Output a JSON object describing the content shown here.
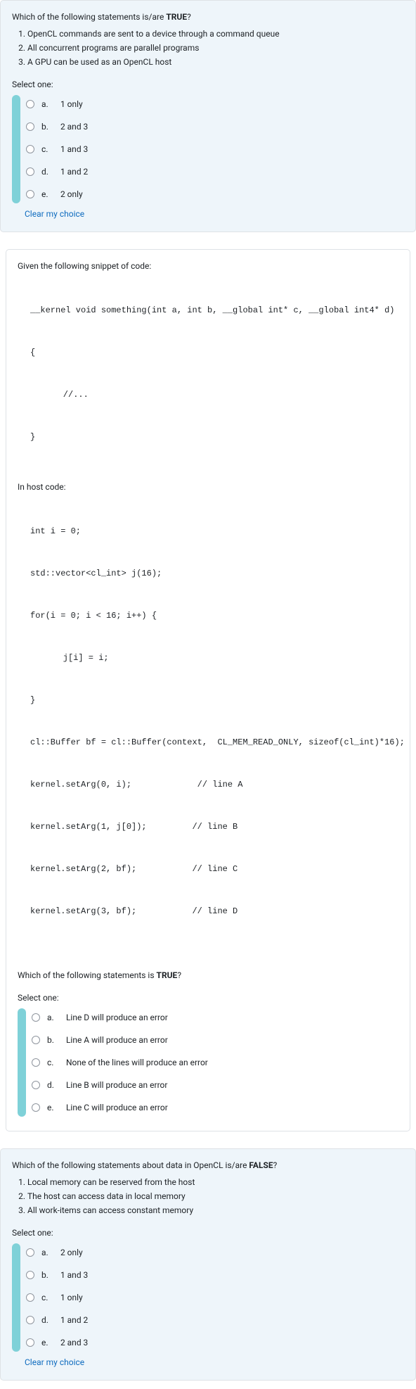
{
  "q1": {
    "prompt_prefix": "Which of the following statements is/are ",
    "prompt_bold": "TRUE",
    "prompt_suffix": "?",
    "stmts": [
      "OpenCL commands are sent to a device through a command queue",
      "All concurrent programs are parallel programs",
      "A GPU can be used as an OpenCL host"
    ],
    "select": "Select one:",
    "options": [
      {
        "letter": "a.",
        "text": "1 only"
      },
      {
        "letter": "b.",
        "text": "2 and 3"
      },
      {
        "letter": "c.",
        "text": "1 and 3"
      },
      {
        "letter": "d.",
        "text": "1 and 2"
      },
      {
        "letter": "e.",
        "text": "2 only"
      }
    ],
    "clear": "Clear my choice"
  },
  "q2": {
    "intro": "Given the following snippet of code:",
    "kernel_lines": [
      "__kernel void something(int a, int b, __global int* c, __global int4* d)",
      "{",
      "    //...",
      "}"
    ],
    "host_header": "In host code:",
    "host_lines": [
      "int i = 0;",
      "std::vector<cl_int> j(16);",
      "for(i = 0; i < 16; i++) {",
      "    j[i] = i;",
      "}",
      "cl::Buffer bf = cl::Buffer(context,  CL_MEM_READ_ONLY, sizeof(cl_int)*16);",
      "kernel.setArg(0, i);             // line A",
      "kernel.setArg(1, j[0]);         // line B",
      "kernel.setArg(2, bf);           // line C",
      "kernel.setArg(3, bf);           // line D"
    ],
    "question_prefix": "Which of the following statements is ",
    "question_bold": "TRUE",
    "question_suffix": "?",
    "select": "Select one:",
    "options": [
      {
        "letter": "a.",
        "text": "Line D will produce an error"
      },
      {
        "letter": "b.",
        "text": "Line A will produce an error"
      },
      {
        "letter": "c.",
        "text": "None of the lines will produce an error"
      },
      {
        "letter": "d.",
        "text": "Line B will produce an error"
      },
      {
        "letter": "e.",
        "text": "Line C will produce an error"
      }
    ]
  },
  "q3": {
    "prompt_prefix": "Which of the following statements about data in OpenCL is/are ",
    "prompt_bold": "FALSE",
    "prompt_suffix": "?",
    "stmts": [
      "Local memory can be reserved from the host",
      "The host can access data in local memory",
      "All work-items can access constant memory"
    ],
    "select": "Select one:",
    "options": [
      {
        "letter": "a.",
        "text": "2 only"
      },
      {
        "letter": "b.",
        "text": "1 and 3"
      },
      {
        "letter": "c.",
        "text": "1 only"
      },
      {
        "letter": "d.",
        "text": "1 and 2"
      },
      {
        "letter": "e.",
        "text": "2 and 3"
      }
    ],
    "clear": "Clear my choice"
  }
}
